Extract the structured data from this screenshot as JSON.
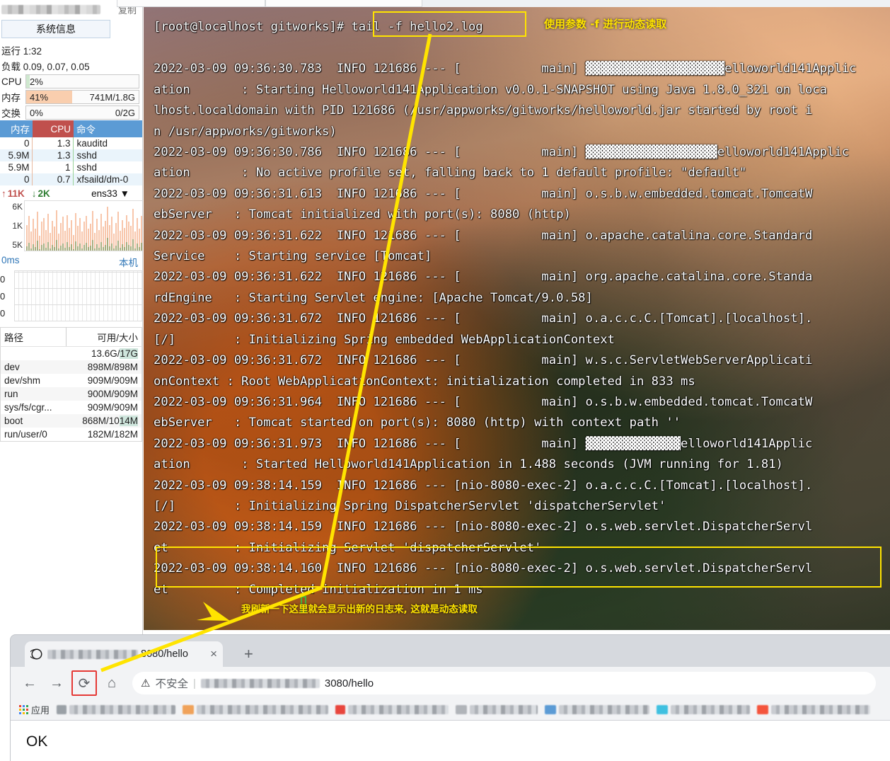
{
  "sidebar": {
    "copy_label": "复制",
    "system_info_button": "系统信息",
    "uptime": {
      "label": "运行 1:32"
    },
    "loadavg": {
      "label": "负载 0.09, 0.07, 0.05"
    },
    "cpu": {
      "label": "CPU",
      "value": "2%",
      "right": ""
    },
    "memory": {
      "label": "内存",
      "value": "41%",
      "right": "741M/1.8G",
      "color": "#f7c9a5"
    },
    "swap": {
      "label": "交换",
      "value": "0%",
      "right": "0/2G"
    },
    "process_table": {
      "headers": [
        "内存",
        "CPU",
        "命令"
      ],
      "rows": [
        {
          "mem": "0",
          "cpu": "1.3",
          "cmd": "kauditd"
        },
        {
          "mem": "5.9M",
          "cpu": "1.3",
          "cmd": "sshd"
        },
        {
          "mem": "5.9M",
          "cpu": "1",
          "cmd": "sshd"
        },
        {
          "mem": "0",
          "cpu": "0.7",
          "cmd": "xfsaild/dm-0"
        }
      ]
    },
    "network": {
      "upload": "11K",
      "download": "2K",
      "interface": "ens33",
      "axis": [
        "6K",
        "1K",
        "5K"
      ]
    },
    "ping": {
      "latency": "0ms",
      "host_label": "本机",
      "axis": [
        "0",
        "0",
        "0"
      ]
    },
    "disk_table": {
      "headers": [
        "路径",
        "可用/大小"
      ],
      "rows": [
        {
          "path": "",
          "value": "13.6G/17G",
          "hl": "17G"
        },
        {
          "path": "dev",
          "value": "898M/898M",
          "hl": ""
        },
        {
          "path": "dev/shm",
          "value": "909M/909M",
          "hl": ""
        },
        {
          "path": "run",
          "value": "900M/909M",
          "hl": ""
        },
        {
          "path": "sys/fs/cgr...",
          "value": "909M/909M",
          "hl": ""
        },
        {
          "path": "boot",
          "value": "868M/1014M",
          "hl": "14M"
        },
        {
          "path": "run/user/0",
          "value": "182M/182M",
          "hl": ""
        }
      ]
    }
  },
  "terminal": {
    "prompt": "[root@localhost gitworks]# ",
    "command": "tail -f hello2.log",
    "lines": [
      "2022-03-09 09:36:30.783  INFO 121686 --- [           main] ▓▓▓▓▓▓▓▓▓▓▓▓▓▓▓▓▓▓▓elloworld141Applic",
      "ation       : Starting Helloworld141Application v0.0.1-SNAPSHOT using Java 1.8.0_321 on loca",
      "lhost.localdomain with PID 121686 (/usr/appworks/gitworks/helloworld.jar started by root i",
      "n /usr/appworks/gitworks)",
      "2022-03-09 09:36:30.786  INFO 121686 --- [           main] ▓▓▓▓▓▓▓▓▓▓▓▓▓▓▓▓▓▓elloworld141Applic",
      "ation       : No active profile set, falling back to 1 default profile: \"default\"",
      "2022-03-09 09:36:31.613  INFO 121686 --- [           main] o.s.b.w.embedded.tomcat.TomcatW",
      "ebServer   : Tomcat initialized with port(s): 8080 (http)",
      "2022-03-09 09:36:31.622  INFO 121686 --- [           main] o.apache.catalina.core.Standard",
      "Service    : Starting service [Tomcat]",
      "2022-03-09 09:36:31.622  INFO 121686 --- [           main] org.apache.catalina.core.Standa",
      "rdEngine   : Starting Servlet engine: [Apache Tomcat/9.0.58]",
      "2022-03-09 09:36:31.672  INFO 121686 --- [           main] o.a.c.c.C.[Tomcat].[localhost].",
      "[/]        : Initializing Spring embedded WebApplicationContext",
      "2022-03-09 09:36:31.672  INFO 121686 --- [           main] w.s.c.ServletWebServerApplicati",
      "onContext : Root WebApplicationContext: initialization completed in 833 ms",
      "2022-03-09 09:36:31.964  INFO 121686 --- [           main] o.s.b.w.embedded.tomcat.TomcatW",
      "ebServer   : Tomcat started on port(s): 8080 (http) with context path ''",
      "2022-03-09 09:36:31.973  INFO 121686 --- [           main] ▓▓▓▓▓▓▓▓▓▓▓▓▓elloworld141Applic",
      "ation       : Started Helloworld141Application in 1.488 seconds (JVM running for 1.81)",
      "2022-03-09 09:38:14.159  INFO 121686 --- [nio-8080-exec-2] o.a.c.c.C.[Tomcat].[localhost].",
      "[/]        : Initializing Spring DispatcherServlet 'dispatcherServlet'",
      "2022-03-09 09:38:14.159  INFO 121686 --- [nio-8080-exec-2] o.s.web.servlet.DispatcherServl",
      "et         : Initializing Servlet 'dispatcherServlet'",
      "2022-03-09 09:38:14.160  INFO 121686 --- [nio-8080-exec-2] o.s.web.servlet.DispatcherServl",
      "et         : Completed initialization in 1 ms"
    ]
  },
  "annotations": {
    "top_note": "使用参数 -f 进行动态读取",
    "bottom_note": "我刷新一下这里就会显示出新的日志来, 这就是动态读取",
    "highlight_color": "#ffe400",
    "reload_box_color": "#e53935"
  },
  "browser": {
    "tab": {
      "title_suffix": "8080/hello",
      "close_label": "×"
    },
    "new_tab_label": "+",
    "nav": {
      "back_icon": "←",
      "forward_icon": "→",
      "reload_icon": "⟳",
      "home_icon": "⌂"
    },
    "omnibox": {
      "warning_icon": "⚠",
      "security_label": "不安全",
      "separator": "|",
      "url_suffix": "3080/hello"
    },
    "bookmarks": {
      "apps_label": "应用",
      "items": [
        "",
        "",
        "",
        "",
        "",
        "",
        "",
        ""
      ]
    },
    "page": {
      "body_text": "OK"
    }
  }
}
